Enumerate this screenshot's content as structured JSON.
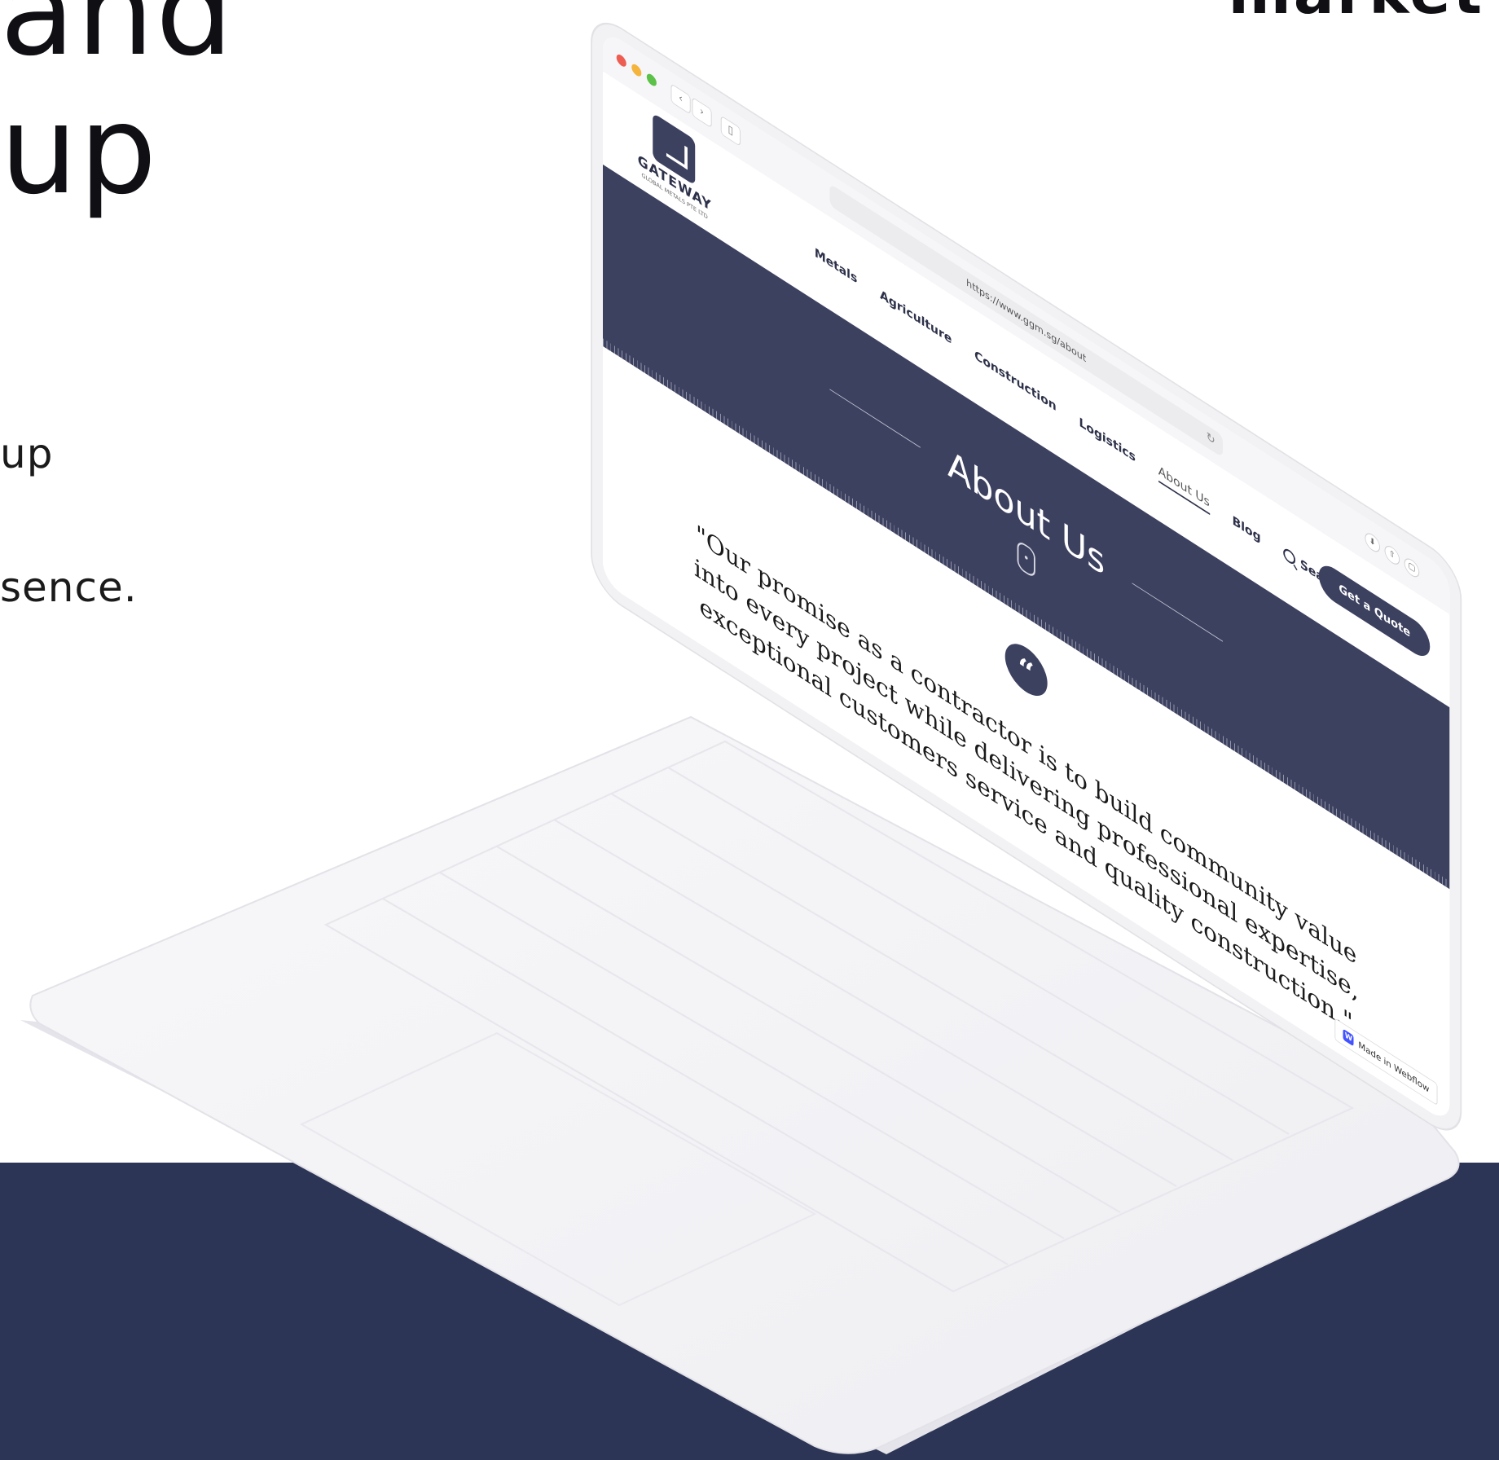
{
  "background": {
    "headline_lines": [
      "and",
      "up"
    ],
    "subtext_lines": [
      "up",
      "sence."
    ],
    "corner_word": "market",
    "band_color": "#2d3556"
  },
  "browser": {
    "url": "https://www.ggm.sg/about",
    "back_icon": "chevron-left-icon",
    "forward_icon": "chevron-right-icon",
    "reload_icon": "reload-icon"
  },
  "site": {
    "logo_text": "GATEWAY",
    "logo_subtext": "GLOBAL METALS PTE LTD",
    "nav": [
      {
        "label": "Metals"
      },
      {
        "label": "Agriculture"
      },
      {
        "label": "Construction"
      },
      {
        "label": "Logistics"
      },
      {
        "label": "About Us",
        "active": true
      },
      {
        "label": "Blog"
      }
    ],
    "search_label": "Search",
    "cta_label": "Get a Quote",
    "brand_color": "#3d4160"
  },
  "hero": {
    "title": "About Us"
  },
  "quote": {
    "icon": "quote-icon",
    "text": "\"Our promise as a contractor is to build community value into every project while delivering professional expertise, exceptional customers service and quality construction.\""
  },
  "webflow_badge": "Made in Webflow"
}
